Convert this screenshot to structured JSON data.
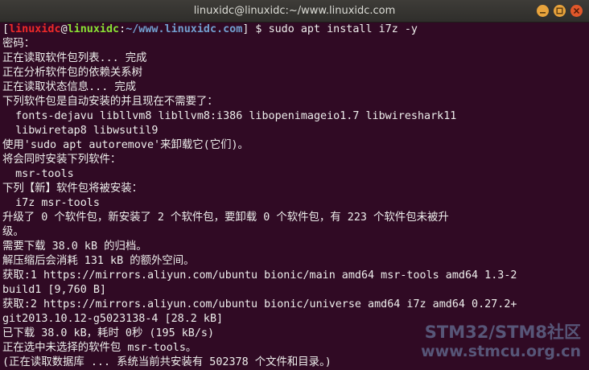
{
  "window": {
    "title": "linuxidc@linuxidc:~/www.linuxidc.com",
    "buttons": [
      "minimize",
      "maximize",
      "close"
    ],
    "colors": {
      "titlebar": "#3c3b37",
      "background": "#300a24",
      "minimize": "#e8a33c",
      "close": "#e0572a"
    }
  },
  "prompt": {
    "open": "[",
    "user": "linuxidc",
    "at": "@",
    "host": "linuxidc",
    "colon": ":",
    "path": "~/www.linuxidc.com",
    "close": "]",
    "symbol": " $ ",
    "command": "sudo apt install i7z -y"
  },
  "output": [
    "密码：",
    "正在读取软件包列表... 完成",
    "正在分析软件包的依赖关系树",
    "正在读取状态信息... 完成",
    "下列软件包是自动安装的并且现在不需要了：",
    "  fonts-dejavu libllvm8 libllvm8:i386 libopenimageio1.7 libwireshark11",
    "  libwiretap8 libwsutil9",
    "使用'sudo apt autoremove'来卸载它(它们)。",
    "将会同时安装下列软件：",
    "  msr-tools",
    "下列【新】软件包将被安装：",
    "  i7z msr-tools",
    "升级了 0 个软件包，新安装了 2 个软件包，要卸载 0 个软件包，有 223 个软件包未被升",
    "级。",
    "需要下载 38.0 kB 的归档。",
    "解压缩后会消耗 131 kB 的额外空间。",
    "获取:1 https://mirrors.aliyun.com/ubuntu bionic/main amd64 msr-tools amd64 1.3-2",
    "build1 [9,760 B]",
    "获取:2 https://mirrors.aliyun.com/ubuntu bionic/universe amd64 i7z amd64 0.27.2+",
    "git2013.10.12-g5023138-4 [28.2 kB]",
    "已下载 38.0 kB，耗时 0秒 (195 kB/s)",
    "正在选中未选择的软件包 msr-tools。",
    "(正在读取数据库 ... 系统当前共安装有 502378 个文件和目录。)"
  ],
  "watermark": {
    "line1": "STM32/STM8社区",
    "line2": "www.stmcu.org.cn"
  }
}
